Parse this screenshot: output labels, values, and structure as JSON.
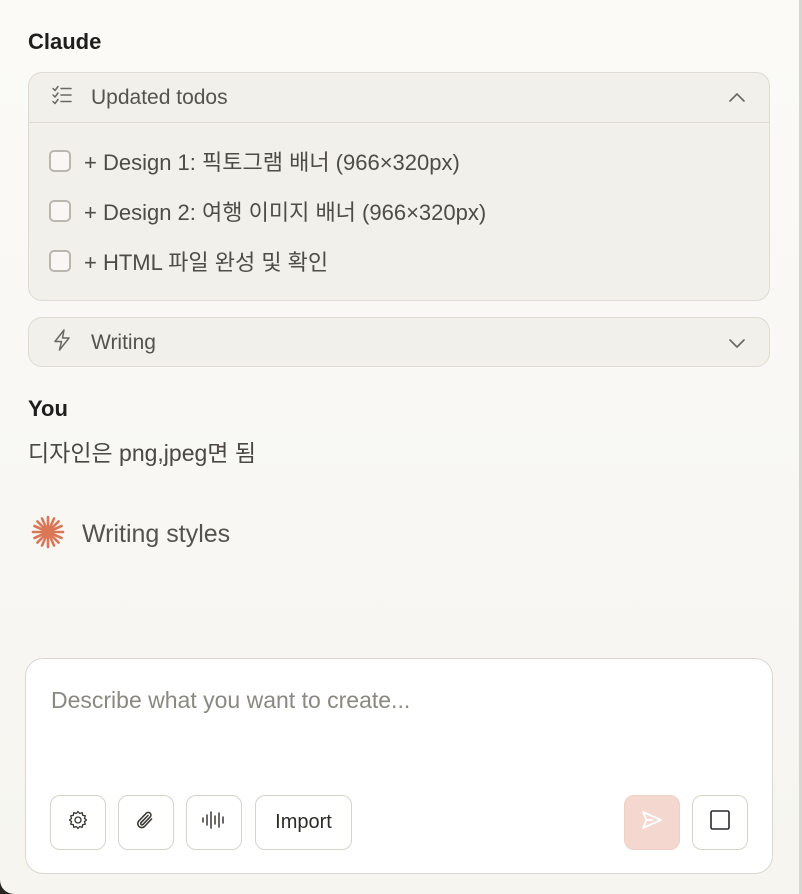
{
  "conversation": {
    "assistant_name": "Claude",
    "todos_card": {
      "title": "Updated todos",
      "items": [
        {
          "text": "+ Design 1: 픽토그램 배너 (966×320px)",
          "checked": false
        },
        {
          "text": "+ Design 2: 여행 이미지 배너 (966×320px)",
          "checked": false
        },
        {
          "text": "+ HTML 파일 완성 및 확인",
          "checked": false
        }
      ]
    },
    "writing_card": {
      "title": "Writing"
    },
    "user_name": "You",
    "user_message": "디자인은 png,jpeg면 됨",
    "status_text": "Writing styles"
  },
  "composer": {
    "placeholder": "Describe what you want to create...",
    "import_label": "Import"
  },
  "icons": {
    "todo": "checklist-icon",
    "writing": "lightning-icon",
    "collapse": "chevron-up-icon",
    "expand": "chevron-down-icon",
    "status": "claude-spark-icon",
    "settings": "gear-icon",
    "attach": "paperclip-icon",
    "voice": "waveform-icon",
    "send": "send-icon",
    "stop": "stop-square-icon"
  },
  "colors": {
    "accent": "#d97757",
    "send_button_bg": "#f4d8cf",
    "panel_bg": "#f8f7f3"
  }
}
